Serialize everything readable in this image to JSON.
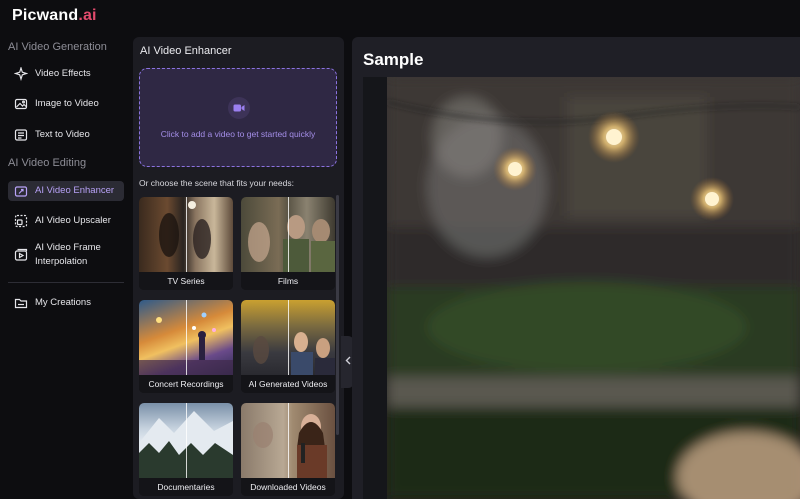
{
  "brand": {
    "name_main": "Picwand",
    "name_accent": ".ai"
  },
  "sidebar": {
    "generation_title": "AI Video Generation",
    "generation_items": [
      {
        "label": "Video Effects",
        "icon": "sparkle-icon"
      },
      {
        "label": "Image to Video",
        "icon": "image-icon"
      },
      {
        "label": "Text to Video",
        "icon": "text-document-icon"
      }
    ],
    "editing_title": "AI Video Editing",
    "editing_items": [
      {
        "label": "AI Video Enhancer",
        "icon": "enhance-video-icon",
        "active": true
      },
      {
        "label": "AI Video Upscaler",
        "icon": "upscale-icon"
      },
      {
        "label_line1": "AI Video Frame",
        "label_line2": "Interpolation",
        "icon": "frame-interpolation-icon"
      }
    ],
    "creations": {
      "label": "My Creations",
      "icon": "folder-icon"
    }
  },
  "panel": {
    "title": "AI Video Enhancer",
    "upload_text": "Click to add a video to get started quickly",
    "upload_icon": "video-camera-icon",
    "scene_hint": "Or choose the scene that fits your needs:",
    "scenes": [
      {
        "label": "TV Series"
      },
      {
        "label": "Films"
      },
      {
        "label": "Concert Recordings"
      },
      {
        "label": "AI Generated Videos"
      },
      {
        "label": "Documentaries"
      },
      {
        "label": "Downloaded Videos"
      }
    ]
  },
  "collapse_icon": "chevron-left-icon",
  "preview": {
    "title": "Sample"
  },
  "colors": {
    "accent": "#b8a2f7",
    "brand_accent": "#e24b6d",
    "upload_bg": "#2f2844"
  }
}
